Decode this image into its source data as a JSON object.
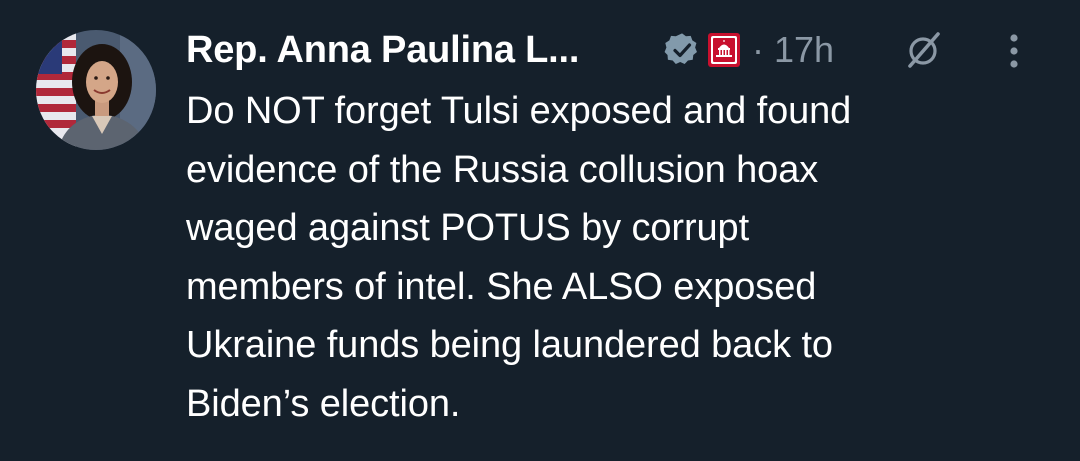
{
  "author": {
    "display_name": "Rep. Anna Paulina L...",
    "verified_icon": "verified-badge-icon",
    "affiliation_icon": "us-capitol-badge-icon",
    "separator": "·",
    "timestamp": "17h"
  },
  "actions": {
    "grok_icon": "grok-icon",
    "more_icon": "more-vertical-icon"
  },
  "tweet": {
    "lines": [
      "Do NOT forget Tulsi exposed and found",
      "evidence of the Russia collusion hoax",
      "waged against POTUS by corrupt",
      "members of intel. She ALSO exposed",
      "Ukraine funds being laundered back to",
      "Biden’s election."
    ]
  },
  "colors": {
    "background": "#15202b",
    "text": "#ffffff",
    "secondary": "#8b98a5",
    "verified": "#829aab",
    "gov_badge": "#c8102e"
  }
}
